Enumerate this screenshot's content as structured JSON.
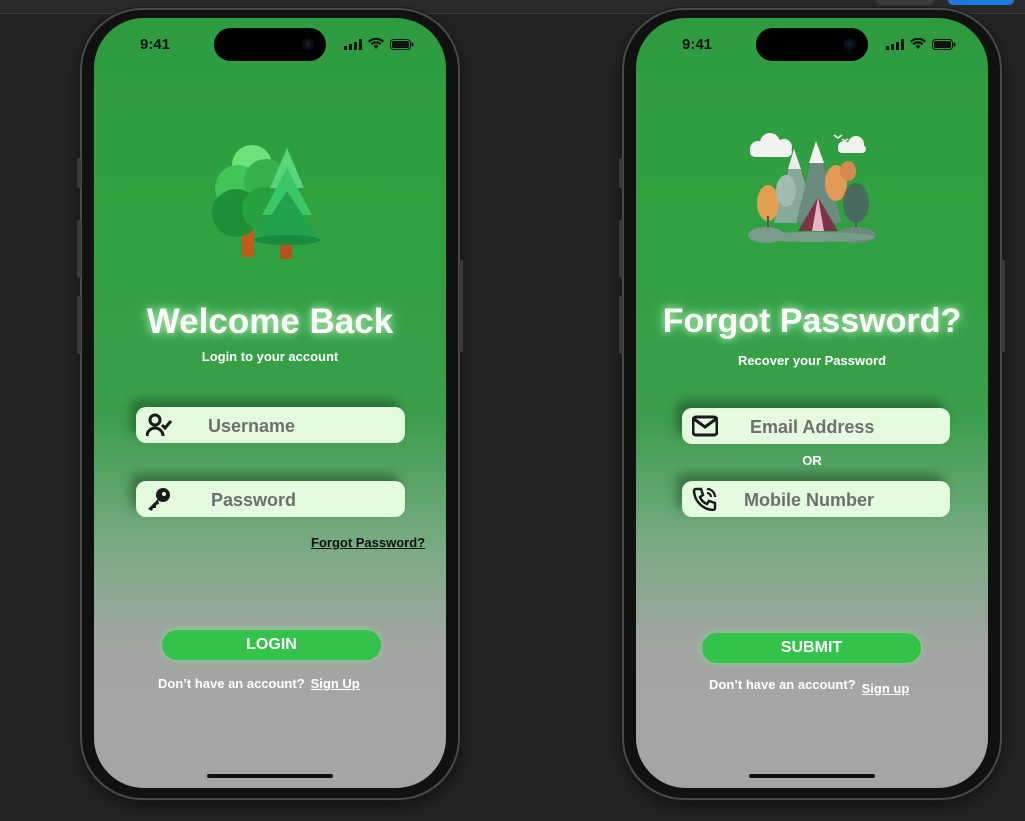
{
  "login": {
    "time": "9:41",
    "title": "Welcome Back",
    "subtitle": "Login to your account",
    "username_placeholder": "Username",
    "password_placeholder": "Password",
    "forgot_link": "Forgot Password?",
    "login_button": "LOGIN",
    "no_account": "Don’t have an account?",
    "signup_link": "Sign Up"
  },
  "forgot": {
    "time": "9:41",
    "title": "Forgot Password?",
    "subtitle": "Recover your Password",
    "email_placeholder": "Email Address",
    "or_label": "OR",
    "mobile_placeholder": "Mobile Number",
    "submit_button": "SUBMIT",
    "no_account": "Don’t have an account?",
    "signup_link": "Sign up"
  },
  "colors": {
    "screen_green": "#30a142",
    "button_green": "#33c34a",
    "field_bg": "#e4fbe0",
    "workspace_bg": "#232323"
  },
  "icons": [
    "user-check-icon",
    "key-icon",
    "mail-icon",
    "phone-call-icon",
    "signal-icon",
    "wifi-icon",
    "battery-icon",
    "tree-illustration",
    "camping-illustration"
  ]
}
